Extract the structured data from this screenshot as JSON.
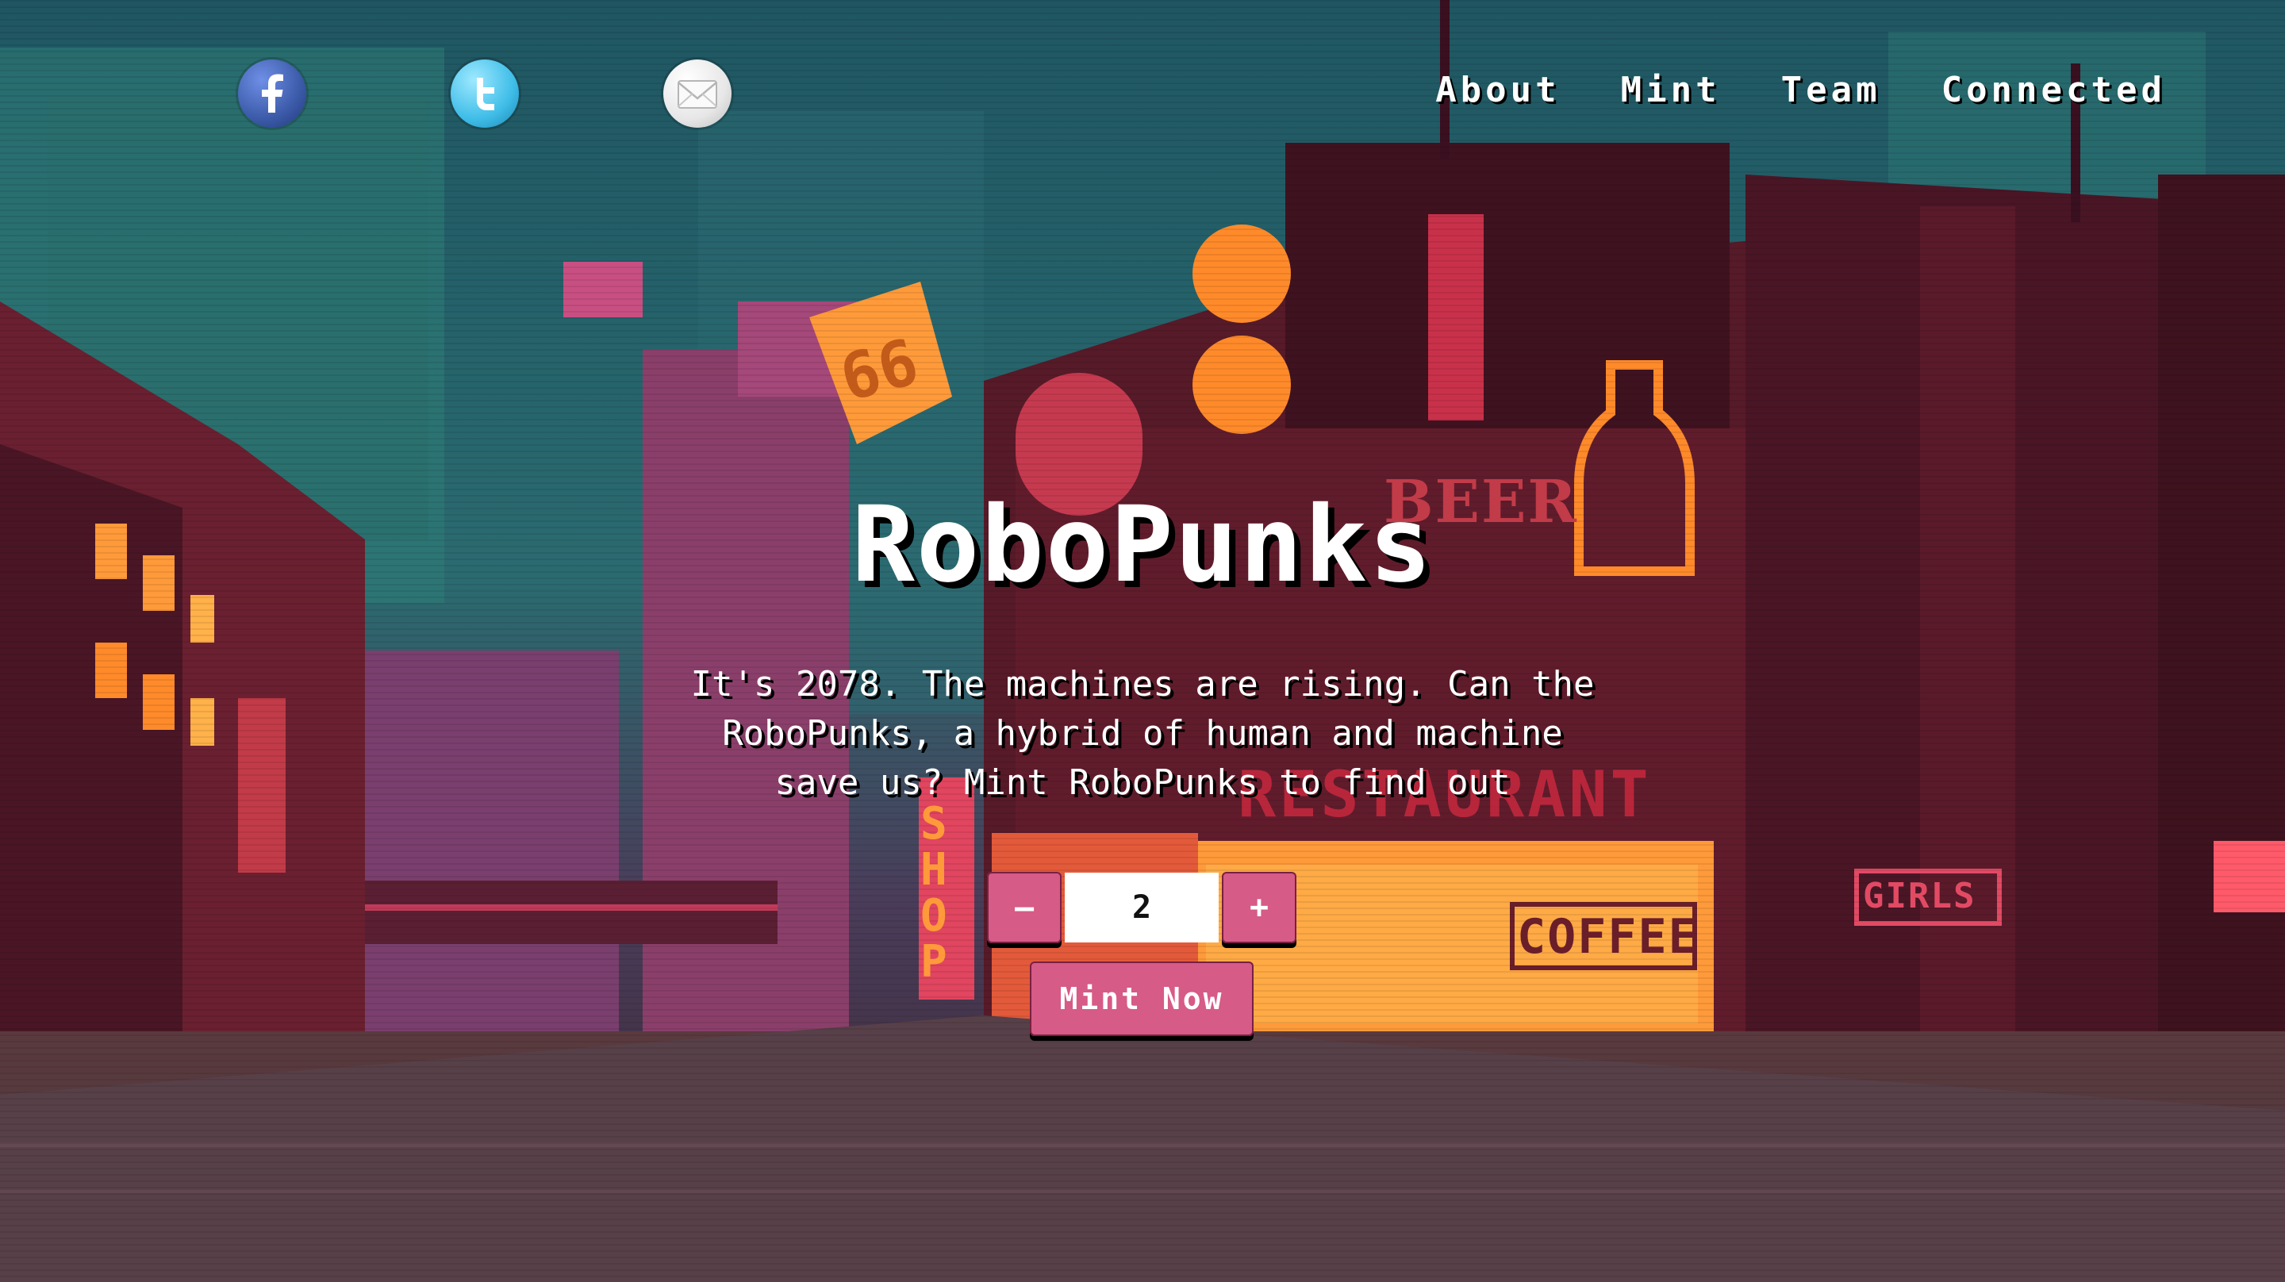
{
  "social": [
    {
      "name": "facebook",
      "icon": "facebook-icon"
    },
    {
      "name": "twitter",
      "icon": "twitter-icon"
    },
    {
      "name": "email",
      "icon": "email-icon"
    }
  ],
  "nav": {
    "about": "About",
    "mint": "Mint",
    "team": "Team",
    "connected": "Connected"
  },
  "hero": {
    "title": "RoboPunks",
    "description_line1": "It's 2078. The machines are rising. Can the",
    "description_line2": "RoboPunks, a hybrid of human and machine",
    "description_line3": "save us? Mint RoboPunks to find out"
  },
  "mint_controls": {
    "decrement_label": "–",
    "quantity": "2",
    "increment_label": "+",
    "mint_button_label": "Mint Now"
  },
  "background_signs": {
    "coffee": "COFFEE",
    "girls": "GIRLS",
    "beer": "BEER",
    "shop": "SHOP",
    "restaurant": "RESTAURANT",
    "sign_66": "66"
  },
  "colors": {
    "button_pink": "#d65b86",
    "sky_teal": "#235f6b",
    "neon_orange": "#ff8a2a",
    "building_red": "#6a1e2a"
  }
}
